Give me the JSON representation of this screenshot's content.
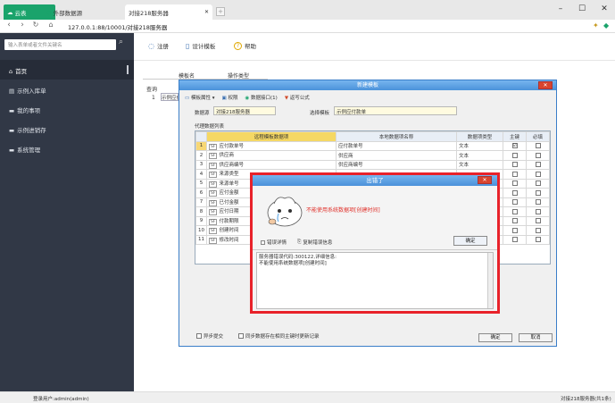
{
  "browser": {
    "brand_tab": "云表",
    "tab2": "外部数据源",
    "tab_active": "对接218服务器",
    "address": "127.0.0.1:88/10001/对接218服务器",
    "minimize": "–",
    "maximize": "☐",
    "close": "✕"
  },
  "sidebar": {
    "search_placeholder": "输入表单或者文件关键名",
    "items": [
      {
        "label": "首页"
      },
      {
        "label": "示例入库单"
      },
      {
        "label": "我的事项"
      },
      {
        "label": "示例进销存"
      },
      {
        "label": "系统管理"
      }
    ]
  },
  "toolbar": {
    "register": "注册",
    "design": "设计模板",
    "help": "帮助"
  },
  "bg": {
    "tab_a": "模板名",
    "tab_b": "操作类型",
    "query": "查询",
    "row_no": "1",
    "row_text": "示例应付款单"
  },
  "dialog": {
    "title": "新建模板",
    "menu": {
      "attr": "模板属性",
      "perm": "权限",
      "iface": "数据接口(1)",
      "expr": "返写公式"
    },
    "db_label": "数据源",
    "db_value": "对接218服务器",
    "tpl_label": "选择模板",
    "tpl_value": "示例应付款单",
    "list_label": "代理数据列表",
    "headers": [
      "远程模板数据项",
      "本地数据项名称",
      "数据项类型",
      "主键",
      "必填"
    ],
    "rows": [
      {
        "n": "1",
        "remote": "应付款单号",
        "local": "应付款单号",
        "type": "文本",
        "pk": "☑",
        "req": ""
      },
      {
        "n": "2",
        "remote": "供应商",
        "local": "供应商",
        "type": "文本",
        "pk": "",
        "req": ""
      },
      {
        "n": "3",
        "remote": "供应商编号",
        "local": "供应商编号",
        "type": "文本",
        "pk": "",
        "req": ""
      },
      {
        "n": "4",
        "remote": "来源类型",
        "local": "",
        "type": "",
        "pk": "",
        "req": ""
      },
      {
        "n": "5",
        "remote": "来源单号",
        "local": "",
        "type": "",
        "pk": "",
        "req": ""
      },
      {
        "n": "6",
        "remote": "应付金额",
        "local": "",
        "type": "",
        "pk": "",
        "req": ""
      },
      {
        "n": "7",
        "remote": "已付金额",
        "local": "",
        "type": "",
        "pk": "",
        "req": ""
      },
      {
        "n": "8",
        "remote": "应付日期",
        "local": "",
        "type": "",
        "pk": "",
        "req": ""
      },
      {
        "n": "9",
        "remote": "付款期限",
        "local": "",
        "type": "",
        "pk": "",
        "req": ""
      },
      {
        "n": "10",
        "remote": "创建时间",
        "local": "",
        "type": "",
        "pk": "",
        "req": ""
      },
      {
        "n": "11",
        "remote": "修改时间",
        "local": "",
        "type": "",
        "pk": "",
        "req": ""
      }
    ],
    "tag": "SF",
    "chk_batch": "异步提交",
    "chk_sync": "同步数据存在相同主键时更新记录",
    "ok": "确定",
    "cancel": "取消"
  },
  "error": {
    "title": "出错了",
    "message": "不能使用系统数据项[创建时间]",
    "detail_toggle": "错误详情",
    "copy": "复制错误信息",
    "ok": "确定",
    "detail": "服务器错误代码:300122,详细信息:\n不能使用系统数据项[创建时间]"
  },
  "status": {
    "user": "登录用户:admin(admin)",
    "right": "对接218服务器(共1条)"
  },
  "colors": {
    "sidebar_bg": "#313846",
    "brand_green": "#1aa36b",
    "title_blue": "#4b92da",
    "error_red": "#e8222a",
    "error_text": "#e0302a",
    "selected_row": "#f7d774"
  },
  "icons": {
    "back": "back-arrow-icon",
    "forward": "forward-arrow-icon",
    "reload": "reload-icon",
    "home": "home-icon",
    "search": "search-icon",
    "help": "question-icon"
  }
}
